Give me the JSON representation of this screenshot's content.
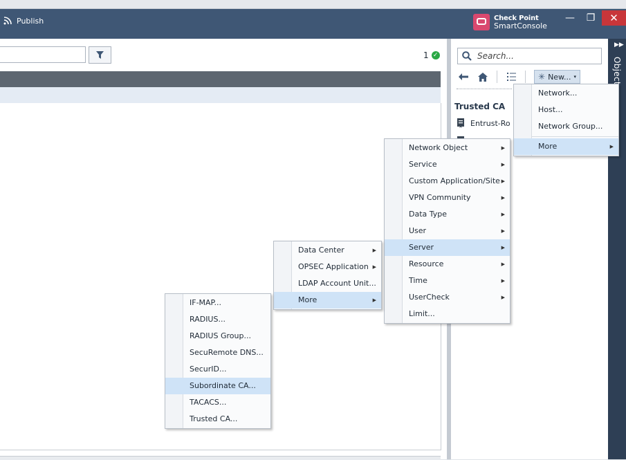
{
  "titlebar": {
    "publish_label": "Publish",
    "brand_line1": "Check Point",
    "brand_line2": "SmartConsole",
    "min_glyph": "—",
    "max_glyph": "❐",
    "close_glyph": "✕"
  },
  "main": {
    "count": "1"
  },
  "objects": {
    "search_placeholder": "Search...",
    "new_label": "New...",
    "heading": "Trusted CA",
    "items": [
      "Entrust-Ro"
    ],
    "sidebar_label": "Objects"
  },
  "menus": {
    "new_menu": [
      {
        "label": "Network...",
        "submenu": false
      },
      {
        "label": "Host...",
        "submenu": false
      },
      {
        "label": "Network Group...",
        "submenu": false
      },
      {
        "label": "More",
        "submenu": true,
        "highlighted": true
      }
    ],
    "more_menu": [
      {
        "label": "Network Object",
        "submenu": true
      },
      {
        "label": "Service",
        "submenu": true
      },
      {
        "label": "Custom Application/Site",
        "submenu": true
      },
      {
        "label": "VPN Community",
        "submenu": true
      },
      {
        "label": "Data Type",
        "submenu": true
      },
      {
        "label": "User",
        "submenu": true
      },
      {
        "label": "Server",
        "submenu": true,
        "highlighted": true
      },
      {
        "label": "Resource",
        "submenu": true
      },
      {
        "label": "Time",
        "submenu": true
      },
      {
        "label": "UserCheck",
        "submenu": true
      },
      {
        "label": "Limit...",
        "submenu": false
      }
    ],
    "server_menu": [
      {
        "label": "Data Center",
        "submenu": true
      },
      {
        "label": "OPSEC Application",
        "submenu": true
      },
      {
        "label": "LDAP Account Unit...",
        "submenu": false
      },
      {
        "label": "More",
        "submenu": true,
        "highlighted": true
      }
    ],
    "server_more_menu": [
      {
        "label": "IF-MAP...",
        "submenu": false
      },
      {
        "label": "RADIUS...",
        "submenu": false
      },
      {
        "label": "RADIUS Group...",
        "submenu": false
      },
      {
        "label": "SecuRemote DNS...",
        "submenu": false
      },
      {
        "label": "SecurID...",
        "submenu": false
      },
      {
        "label": "Subordinate CA...",
        "submenu": false,
        "highlighted": true
      },
      {
        "label": "TACACS...",
        "submenu": false
      },
      {
        "label": "Trusted CA...",
        "submenu": false
      }
    ]
  },
  "colors": {
    "titlebar": "#3f5775",
    "highlight": "#cfe3f7",
    "close": "#c8363a",
    "ok": "#2aa844"
  }
}
